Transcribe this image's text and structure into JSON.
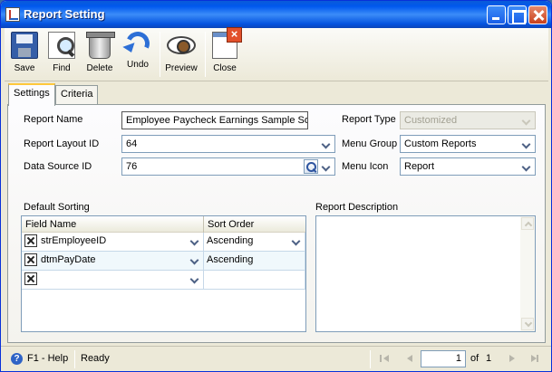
{
  "window": {
    "title": "Report Setting"
  },
  "toolbar": {
    "save": "Save",
    "find": "Find",
    "delete": "Delete",
    "undo": "Undo",
    "preview": "Preview",
    "close": "Close"
  },
  "tabs": {
    "settings": "Settings",
    "criteria": "Criteria"
  },
  "form": {
    "report_name_label": "Report Name",
    "report_name_value": "Employee Paycheck Earnings Sample Sort",
    "report_type_label": "Report Type",
    "report_type_value": "Customized",
    "layout_label": "Report Layout ID",
    "layout_value": "64",
    "menu_group_label": "Menu Group",
    "menu_group_value": "Custom Reports",
    "data_source_label": "Data Source ID",
    "data_source_value": "76",
    "menu_icon_label": "Menu Icon",
    "menu_icon_value": "Report"
  },
  "sorting": {
    "title": "Default Sorting",
    "columns": [
      "Field Name",
      "Sort Order"
    ],
    "rows": [
      {
        "field": "strEmployeeID",
        "order": "Ascending"
      },
      {
        "field": "dtmPayDate",
        "order": "Ascending"
      },
      {
        "field": "",
        "order": ""
      }
    ]
  },
  "description": {
    "title": "Report Description",
    "value": ""
  },
  "status": {
    "help": "F1 - Help",
    "state": "Ready",
    "page_current": "1",
    "of": "of",
    "page_total": "1"
  },
  "colors": {
    "title_bar": "#0058ee",
    "window_bg": "#ece9d8",
    "tab_accent": "#ffc83c",
    "field_border": "#7f9db9"
  },
  "icons": [
    "save-icon",
    "find-icon",
    "delete-icon",
    "undo-icon",
    "preview-icon",
    "close-icon",
    "help-icon",
    "lookup-icon"
  ]
}
